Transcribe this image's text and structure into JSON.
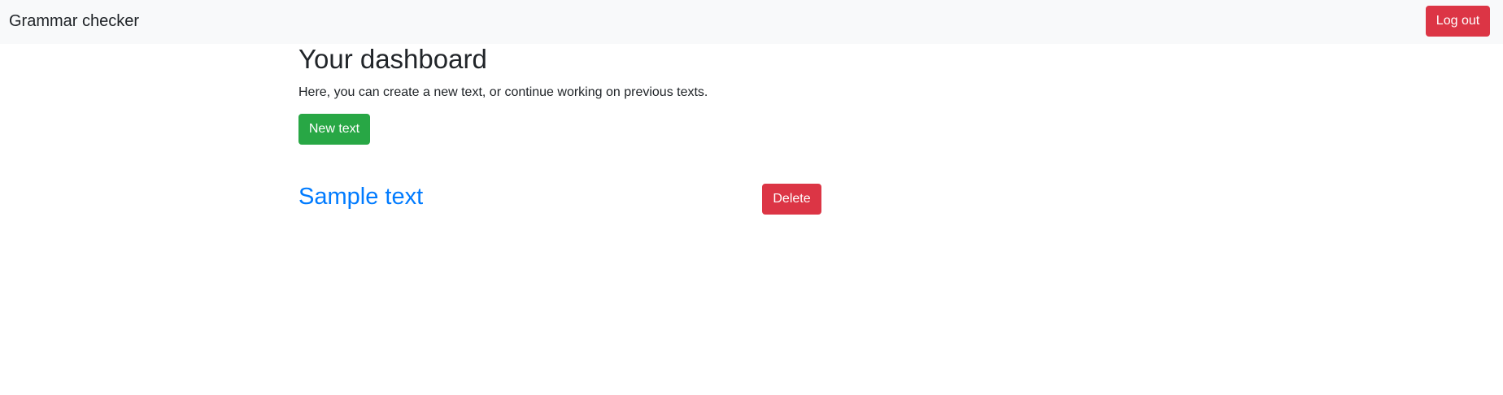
{
  "navbar": {
    "brand": "Grammar checker",
    "logout_label": "Log out"
  },
  "main": {
    "title": "Your dashboard",
    "description": "Here, you can create a new text, or continue working on previous texts.",
    "new_text_label": "New text",
    "texts": [
      {
        "title": "Sample text",
        "delete_label": "Delete"
      }
    ]
  },
  "colors": {
    "navbar_bg": "#f8f9fa",
    "danger": "#dc3545",
    "success": "#28a745",
    "link": "#007bff"
  }
}
